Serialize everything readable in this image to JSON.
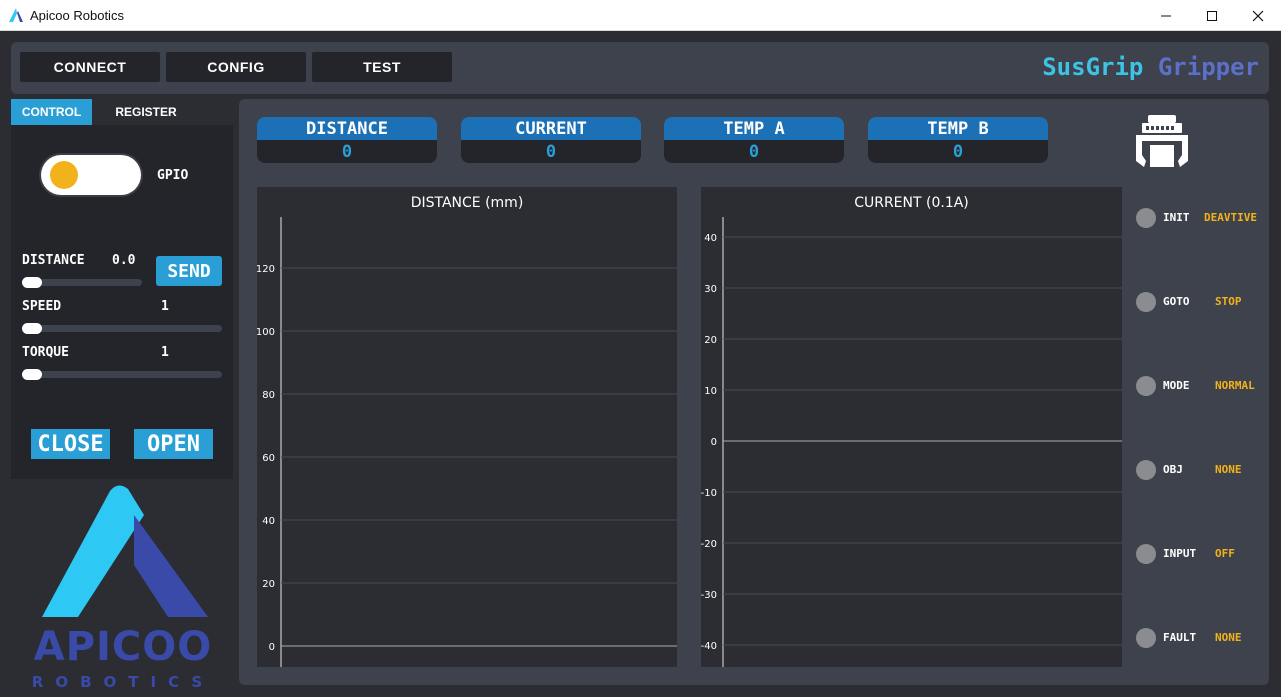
{
  "window": {
    "title": "Apicoo Robotics",
    "minimize_glyph": "─",
    "maximize_glyph": "☐",
    "close_glyph": "✕"
  },
  "nav": {
    "buttons": [
      "CONNECT",
      "CONFIG",
      "TEST"
    ],
    "brand_primary": "SusGrip",
    "brand_secondary": "Gripper"
  },
  "tabs": {
    "control": "CONTROL",
    "register": "REGISTER"
  },
  "control": {
    "gpio_label": "GPIO",
    "gpio_on": false,
    "distance_label": "DISTANCE",
    "distance_value": "0.0",
    "distance_level": 0,
    "send_label": "SEND",
    "speed_label": "SPEED",
    "speed_value": "1",
    "speed_level": 0,
    "torque_label": "TORQUE",
    "torque_value": "1",
    "torque_level": 0,
    "close_label": "CLOSE",
    "open_label": "OPEN"
  },
  "logo": {
    "wordmark": "APICOO",
    "subtitle": "ROBOTICS"
  },
  "metrics": [
    {
      "label": "DISTANCE",
      "value": "0"
    },
    {
      "label": "CURRENT",
      "value": "0"
    },
    {
      "label": "TEMP A",
      "value": "0"
    },
    {
      "label": "TEMP B",
      "value": "0"
    }
  ],
  "charts": {
    "distance": {
      "title": "DISTANCE (mm)",
      "yticks": [
        "120",
        "100",
        "80",
        "60",
        "40",
        "20",
        "0"
      ]
    },
    "current": {
      "title": "CURRENT (0.1A)",
      "yticks": [
        "40",
        "30",
        "20",
        "10",
        "0",
        "-10",
        "-20",
        "-30",
        "-40"
      ]
    }
  },
  "status": [
    {
      "name": "INIT",
      "value": "DEAVTIVE"
    },
    {
      "name": "GOTO",
      "value": "STOP"
    },
    {
      "name": "MODE",
      "value": "NORMAL"
    },
    {
      "name": "OBJ",
      "value": "NONE"
    },
    {
      "name": "INPUT",
      "value": "OFF"
    },
    {
      "name": "FAULT",
      "value": "NONE"
    }
  ],
  "colors": {
    "accent": "#2a9fd6",
    "metric_header": "#1c70b5",
    "status_value": "#f2b21b",
    "brand_primary": "#3ec3e6",
    "brand_secondary": "#5c6fc9",
    "logo_light": "#2ec8f4",
    "logo_dark": "#3a4aa8"
  }
}
